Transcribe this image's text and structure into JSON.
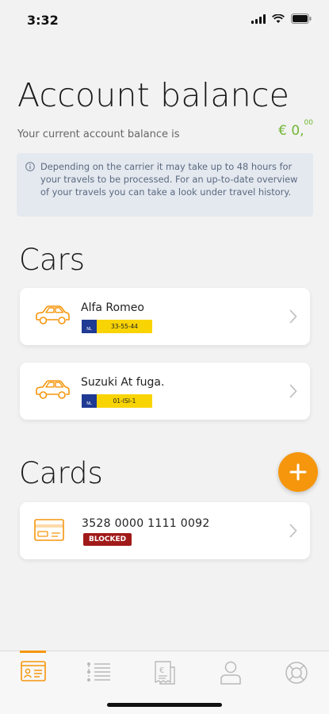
{
  "status": {
    "time": "3:32"
  },
  "header": {
    "title": "Account balance"
  },
  "balance": {
    "label": "Your current account balance is",
    "currency": "€ 0,",
    "cents": "00"
  },
  "info": {
    "text": "Depending on the carrier it may take up to 48 hours for your travels to be processed. For an up-to-date overview of your travels you can take a look under travel history."
  },
  "cars": {
    "title": "Cars",
    "items": [
      {
        "name": "Alfa Romeo",
        "country": "NL",
        "plate": "33-55-44"
      },
      {
        "name": "Suzuki At fuga.",
        "country": "NL",
        "plate": "01-ISI-1"
      }
    ]
  },
  "cards": {
    "title": "Cards",
    "items": [
      {
        "number": "3528 0000 1111 0092",
        "status": "BLOCKED"
      }
    ]
  },
  "colors": {
    "accent": "#f5960d",
    "balance": "#71b735",
    "blocked": "#a11a1a",
    "plate": "#f9d404"
  },
  "tabs": [
    {
      "icon": "id-card-icon",
      "active": true
    },
    {
      "icon": "list-icon",
      "active": false
    },
    {
      "icon": "receipt-icon",
      "active": false
    },
    {
      "icon": "user-icon",
      "active": false
    },
    {
      "icon": "lifebuoy-icon",
      "active": false
    }
  ]
}
